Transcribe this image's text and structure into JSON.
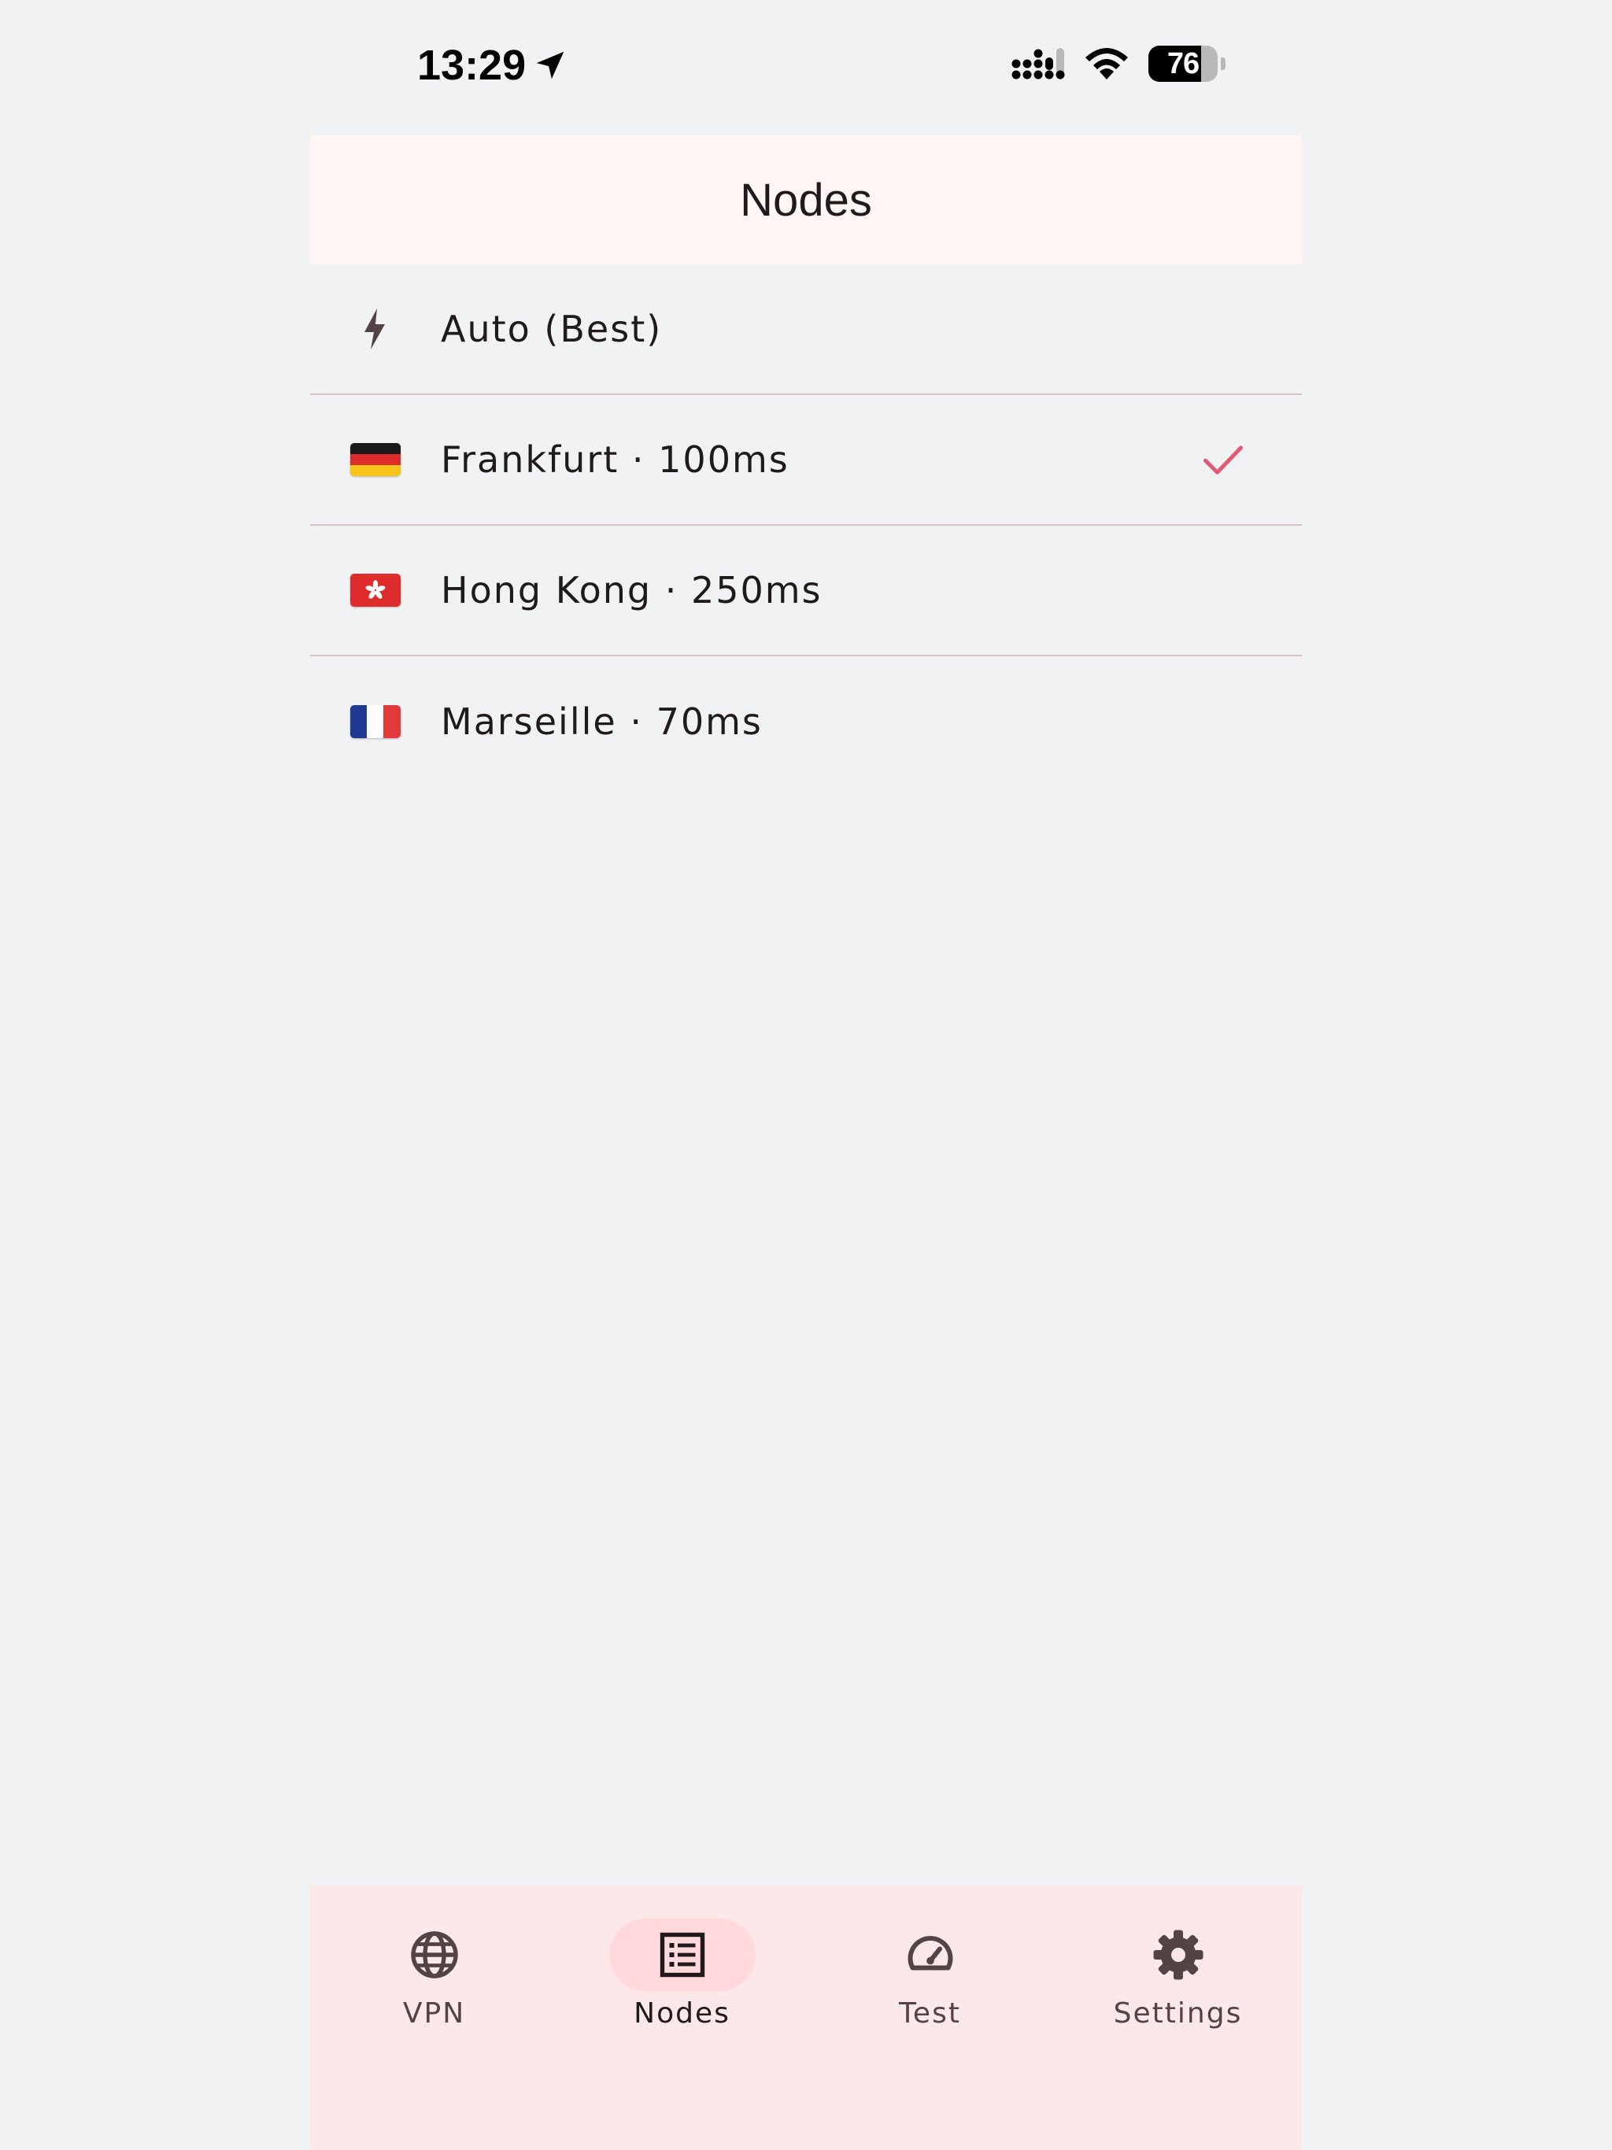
{
  "status_bar": {
    "time": "13:29",
    "battery_level": "76",
    "battery_percent": 76
  },
  "app_bar": {
    "title": "Nodes"
  },
  "nodes": [
    {
      "label": "Auto (Best)",
      "icon": "bolt-icon",
      "selected": false
    },
    {
      "label": "Frankfurt · 100ms",
      "icon": "germany-flag-icon",
      "selected": true
    },
    {
      "label": "Hong Kong · 250ms",
      "icon": "hong-kong-flag-icon",
      "selected": false
    },
    {
      "label": "Marseille · 70ms",
      "icon": "france-flag-icon",
      "selected": false
    }
  ],
  "bottom_nav": {
    "items": [
      {
        "label": "VPN",
        "icon": "globe-icon",
        "active": false
      },
      {
        "label": "Nodes",
        "icon": "list-icon",
        "active": true
      },
      {
        "label": "Test",
        "icon": "speedometer-icon",
        "active": false
      },
      {
        "label": "Settings",
        "icon": "gear-icon",
        "active": false
      }
    ]
  },
  "colors": {
    "background": "#f1f2f4",
    "app_bar": "#fff6f5",
    "bottom_nav": "#fce8e9",
    "active_indicator": "#ffd9dc",
    "check": "#e05a73",
    "divider": "#d8c2c4"
  }
}
